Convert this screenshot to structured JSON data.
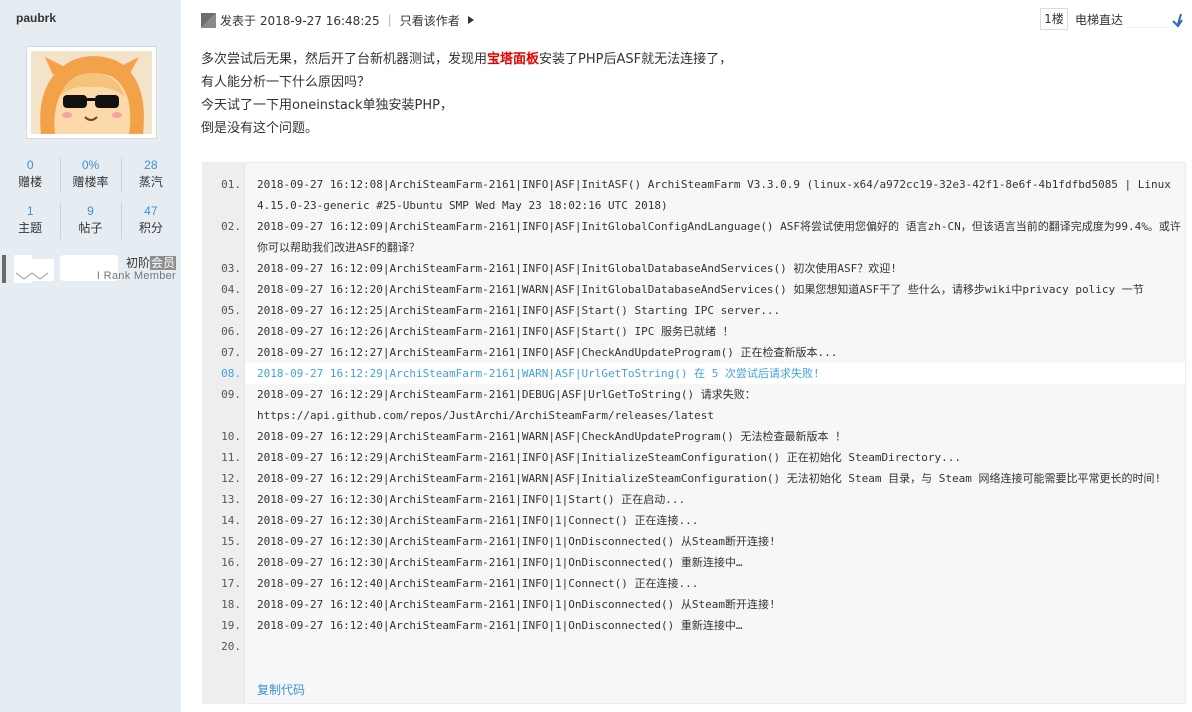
{
  "user": {
    "name": "paubrk",
    "stats": [
      {
        "num": "0",
        "label": "赠楼"
      },
      {
        "num": "0%",
        "label": "赠楼率"
      },
      {
        "num": "28",
        "label": "蒸汽"
      },
      {
        "num": "1",
        "label": "主题"
      },
      {
        "num": "9",
        "label": "帖子"
      },
      {
        "num": "47",
        "label": "积分"
      }
    ],
    "rank_title_a": "初阶",
    "rank_title_b": "会员",
    "rank_sub": "I Rank Member"
  },
  "post": {
    "date": "发表于 2018-9-27 16:48:25",
    "sep": "|",
    "only_author": "只看该作者",
    "floor": "1楼",
    "jump_label": "电梯直达",
    "body": {
      "line1_a": "多次尝试后无果，然后开了台新机器测试，发现用",
      "line1_red": "宝塔面板",
      "line1_b": "安装了PHP后ASF就无法连接了，",
      "line2": "有人能分析一下什么原因吗？",
      "line3": "今天试了一下用oneinstack单独安装PHP，",
      "line4": "倒是没有这个问题。"
    }
  },
  "code": {
    "lines": [
      {
        "n": "01.",
        "t": "2018-09-27 16:12:08|ArchiSteamFarm-2161|INFO|ASF|InitASF() ArchiSteamFarm V3.3.0.9 (linux-x64/a972cc19-32e3-42f1-8e6f-4b1fdfbd5085 | Linux 4.15.0-23-generic #25-Ubuntu SMP Wed May 23 18:02:16 UTC 2018)"
      },
      {
        "n": "02.",
        "t": "2018-09-27 16:12:09|ArchiSteamFarm-2161|INFO|ASF|InitGlobalConfigAndLanguage() ASF将尝试使用您偏好的 语言zh-CN，但该语言当前的翻译完成度为99.4%。或许你可以帮助我们改进ASF的翻译？"
      },
      {
        "n": "03.",
        "t": "2018-09-27 16:12:09|ArchiSteamFarm-2161|INFO|ASF|InitGlobalDatabaseAndServices() 初次使用ASF？欢迎!"
      },
      {
        "n": "04.",
        "t": "2018-09-27 16:12:20|ArchiSteamFarm-2161|WARN|ASF|InitGlobalDatabaseAndServices() 如果您想知道ASF干了 些什么，请移步wiki中privacy policy 一节"
      },
      {
        "n": "05.",
        "t": "2018-09-27 16:12:25|ArchiSteamFarm-2161|INFO|ASF|Start() Starting IPC server..."
      },
      {
        "n": "06.",
        "t": "2018-09-27 16:12:26|ArchiSteamFarm-2161|INFO|ASF|Start() IPC 服务已就绪 ！"
      },
      {
        "n": "07.",
        "t": "2018-09-27 16:12:27|ArchiSteamFarm-2161|INFO|ASF|CheckAndUpdateProgram() 正在检查新版本..."
      },
      {
        "n": "08.",
        "t": "2018-09-27 16:12:29|ArchiSteamFarm-2161|WARN|ASF|UrlGetToString() 在 5 次尝试后请求失败!"
      },
      {
        "n": "09.",
        "t": "2018-09-27 16:12:29|ArchiSteamFarm-2161|DEBUG|ASF|UrlGetToString() 请求失败：\nhttps://api.github.com/repos/JustArchi/ArchiSteamFarm/releases/latest"
      },
      {
        "n": "10.",
        "t": "2018-09-27 16:12:29|ArchiSteamFarm-2161|WARN|ASF|CheckAndUpdateProgram() 无法检查最新版本 ！"
      },
      {
        "n": "11.",
        "t": "2018-09-27 16:12:29|ArchiSteamFarm-2161|INFO|ASF|InitializeSteamConfiguration() 正在初始化 SteamDirectory..."
      },
      {
        "n": "12.",
        "t": "2018-09-27 16:12:29|ArchiSteamFarm-2161|WARN|ASF|InitializeSteamConfiguration() 无法初始化 Steam 目录，与 Steam 网络连接可能需要比平常更长的时间!"
      },
      {
        "n": "13.",
        "t": "2018-09-27 16:12:30|ArchiSteamFarm-2161|INFO|1|Start() 正在启动..."
      },
      {
        "n": "14.",
        "t": "2018-09-27 16:12:30|ArchiSteamFarm-2161|INFO|1|Connect() 正在连接..."
      },
      {
        "n": "15.",
        "t": "2018-09-27 16:12:30|ArchiSteamFarm-2161|INFO|1|OnDisconnected() 从Steam断开连接!"
      },
      {
        "n": "16.",
        "t": "2018-09-27 16:12:30|ArchiSteamFarm-2161|INFO|1|OnDisconnected() 重新连接中…"
      },
      {
        "n": "17.",
        "t": "2018-09-27 16:12:40|ArchiSteamFarm-2161|INFO|1|Connect() 正在连接..."
      },
      {
        "n": "18.",
        "t": "2018-09-27 16:12:40|ArchiSteamFarm-2161|INFO|1|OnDisconnected() 从Steam断开连接!"
      },
      {
        "n": "19.",
        "t": "2018-09-27 16:12:40|ArchiSteamFarm-2161|INFO|1|OnDisconnected() 重新连接中…"
      },
      {
        "n": "20.",
        "t": ""
      }
    ],
    "highlight_index": 7,
    "copy_label": "复制代码"
  },
  "colors": {
    "sidebar_bg": "#e5edf2",
    "link_blue": "#3f8fd2",
    "highlight_blue": "#3ea2e0",
    "emphasis_red": "#e60000"
  },
  "icons": {
    "post": "post-icon",
    "author_arrow": "triangle-right-icon",
    "jump": "jump-arrow-icon",
    "rank": "rank-badge-icon"
  }
}
